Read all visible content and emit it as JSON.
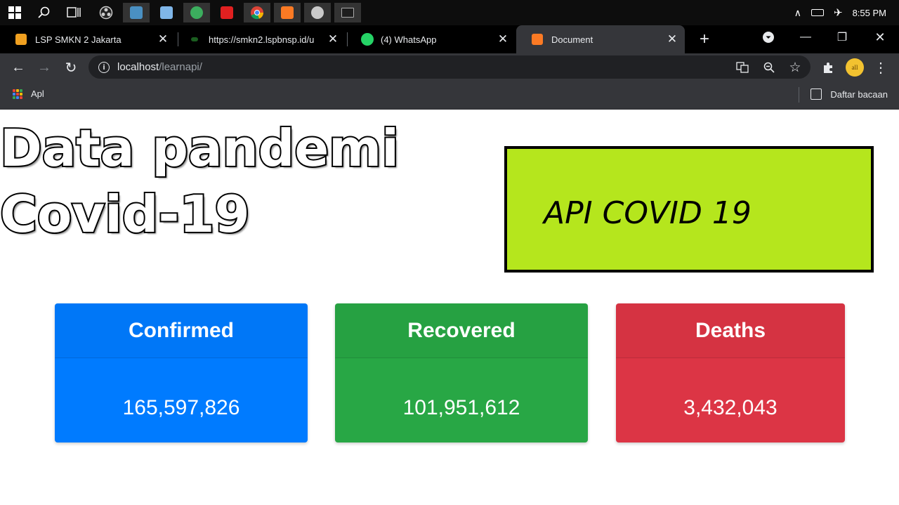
{
  "taskbar": {
    "icons": [
      "windows-start-icon",
      "search-icon",
      "task-view-icon",
      "obs-icon",
      "app-icon",
      "app-icon",
      "edge-icon",
      "acrobat-icon",
      "chrome-icon",
      "xampp-icon",
      "paint-icon",
      "terminal-icon"
    ],
    "clock": "8:55 PM"
  },
  "tabs": [
    {
      "title": "LSP SMKN 2 Jakarta",
      "favicon_color": "#f0a020"
    },
    {
      "title": "https://smkn2.lspbnsp.id/u",
      "favicon_color": "#2e7d32"
    },
    {
      "title": "(4) WhatsApp",
      "favicon_color": "#25d366"
    },
    {
      "title": "Document",
      "favicon_color": "#fb7a24"
    }
  ],
  "address_bar": {
    "host": "localhost",
    "path": "/learnapi/"
  },
  "bookmarks": {
    "apps_label": "Apl",
    "reading_list_label": "Daftar bacaan"
  },
  "page": {
    "heading_line1": "Data pandemi",
    "heading_line2": "Covid-19",
    "api_label": "API COVID 19",
    "api_box_color": "#b5e61d",
    "cards": [
      {
        "title": "Confirmed",
        "value": "165,597,826",
        "color": "#007bff"
      },
      {
        "title": "Recovered",
        "value": "101,951,612",
        "color": "#28a745"
      },
      {
        "title": "Deaths",
        "value": "3,432,043",
        "color": "#dc3545"
      }
    ]
  },
  "avatar_text": "all"
}
